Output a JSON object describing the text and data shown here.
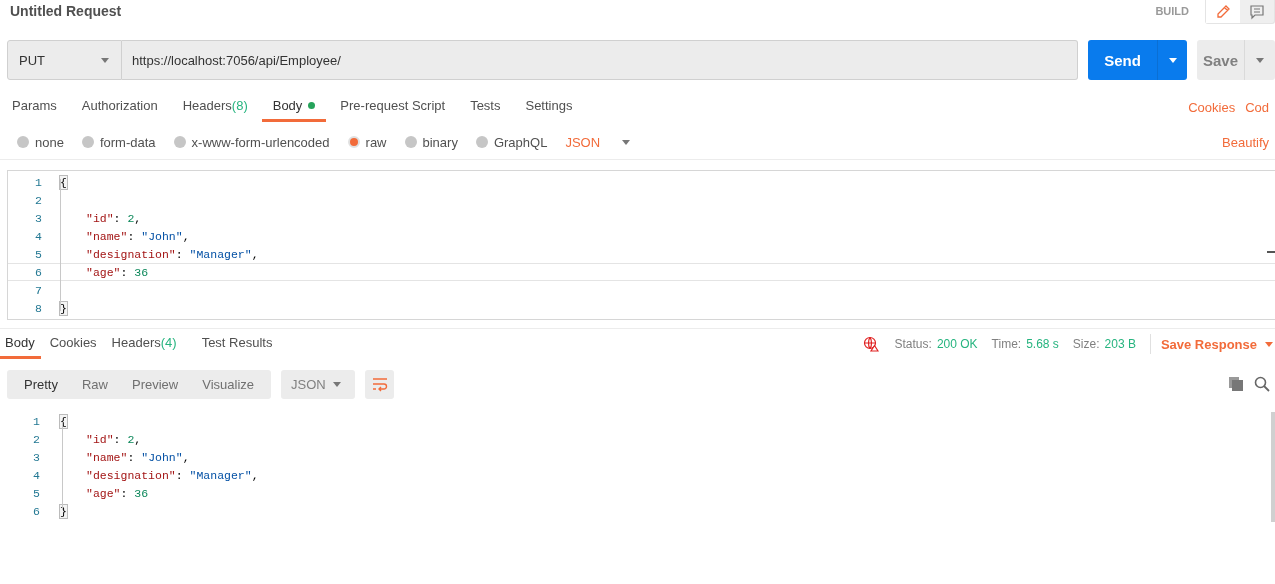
{
  "title": "Untitled Request",
  "mode": {
    "label": "BUILD"
  },
  "request": {
    "method": "PUT",
    "url": "https://localhost:7056/api/Employee/",
    "send": "Send",
    "save": "Save"
  },
  "tabs": [
    {
      "label": "Params",
      "selected": false,
      "dot": false
    },
    {
      "label": "Authorization",
      "selected": false,
      "dot": false
    },
    {
      "label": "Headers",
      "count": "(8)",
      "selected": false,
      "dot": false
    },
    {
      "label": "Body",
      "selected": true,
      "dot": true
    },
    {
      "label": "Pre-request Script",
      "selected": false,
      "dot": false
    },
    {
      "label": "Tests",
      "selected": false,
      "dot": false
    },
    {
      "label": "Settings",
      "selected": false,
      "dot": false
    }
  ],
  "links": [
    "Cookies",
    "Cod"
  ],
  "body_types": [
    {
      "label": "none",
      "selected": false
    },
    {
      "label": "form-data",
      "selected": false
    },
    {
      "label": "x-www-form-urlencoded",
      "selected": false
    },
    {
      "label": "raw",
      "selected": true
    },
    {
      "label": "binary",
      "selected": false
    },
    {
      "label": "GraphQL",
      "selected": false
    }
  ],
  "format": "JSON",
  "beautify": "Beautify",
  "editor": [
    {
      "number": "1",
      "indented": false,
      "active": false,
      "tokens": [
        {
          "kind": "brace",
          "text": "{"
        }
      ]
    },
    {
      "number": "2",
      "active": false
    },
    {
      "number": "3",
      "indented": true,
      "active": false,
      "tokens": [
        {
          "kind": "key",
          "text": "\"id\""
        },
        {
          "kind": "punct",
          "text": ": "
        },
        {
          "kind": "number",
          "text": "2"
        },
        {
          "kind": "punct",
          "text": ","
        }
      ]
    },
    {
      "number": "4",
      "indented": true,
      "active": false,
      "tokens": [
        {
          "kind": "key",
          "text": "\"name\""
        },
        {
          "kind": "punct",
          "text": ": "
        },
        {
          "kind": "string",
          "text": "\"John\""
        },
        {
          "kind": "punct",
          "text": ","
        }
      ]
    },
    {
      "number": "5",
      "indented": true,
      "active": false,
      "tokens": [
        {
          "kind": "key",
          "text": "\"designation\""
        },
        {
          "kind": "punct",
          "text": ": "
        },
        {
          "kind": "string",
          "text": "\"Manager\""
        },
        {
          "kind": "punct",
          "text": ","
        }
      ]
    },
    {
      "number": "6",
      "indented": true,
      "active": true,
      "tokens": [
        {
          "kind": "key",
          "text": "\"age\""
        },
        {
          "kind": "punct",
          "text": ": "
        },
        {
          "kind": "number",
          "text": "36"
        }
      ]
    },
    {
      "number": "7",
      "active": false
    },
    {
      "number": "8",
      "indented": false,
      "active": false,
      "tokens": [
        {
          "kind": "brace",
          "text": "}"
        }
      ]
    }
  ],
  "response": {
    "tabs": [
      {
        "label": "Body",
        "selected": true
      },
      {
        "label": "Cookies",
        "selected": false
      },
      {
        "label": "Headers",
        "count": "(4)",
        "selected": false
      },
      {
        "label": "Test Results",
        "selected": false
      }
    ],
    "stats": [
      {
        "label": "Status:",
        "value": "200 OK"
      },
      {
        "label": "Time:",
        "value": "5.68 s"
      },
      {
        "label": "Size:",
        "value": "203 B"
      }
    ],
    "save": "Save Response",
    "views": [
      {
        "label": "Pretty",
        "selected": true
      },
      {
        "label": "Raw",
        "selected": false
      },
      {
        "label": "Preview",
        "selected": false
      },
      {
        "label": "Visualize",
        "selected": false
      }
    ],
    "format": "JSON",
    "lines": [
      {
        "number": "1",
        "indented": false,
        "tokens": [
          {
            "kind": "brace",
            "text": "{"
          }
        ]
      },
      {
        "number": "2",
        "indented": true,
        "tokens": [
          {
            "kind": "key",
            "text": "\"id\""
          },
          {
            "kind": "punct",
            "text": ": "
          },
          {
            "kind": "number",
            "text": "2"
          },
          {
            "kind": "punct",
            "text": ","
          }
        ]
      },
      {
        "number": "3",
        "indented": true,
        "tokens": [
          {
            "kind": "key",
            "text": "\"name\""
          },
          {
            "kind": "punct",
            "text": ": "
          },
          {
            "kind": "string",
            "text": "\"John\""
          },
          {
            "kind": "punct",
            "text": ","
          }
        ]
      },
      {
        "number": "4",
        "indented": true,
        "tokens": [
          {
            "kind": "key",
            "text": "\"designation\""
          },
          {
            "kind": "punct",
            "text": ": "
          },
          {
            "kind": "string",
            "text": "\"Manager\""
          },
          {
            "kind": "punct",
            "text": ","
          }
        ]
      },
      {
        "number": "5",
        "indented": true,
        "tokens": [
          {
            "kind": "key",
            "text": "\"age\""
          },
          {
            "kind": "punct",
            "text": ": "
          },
          {
            "kind": "number",
            "text": "36"
          }
        ]
      },
      {
        "number": "6",
        "indented": false,
        "tokens": [
          {
            "kind": "brace",
            "text": "}"
          }
        ]
      }
    ]
  }
}
